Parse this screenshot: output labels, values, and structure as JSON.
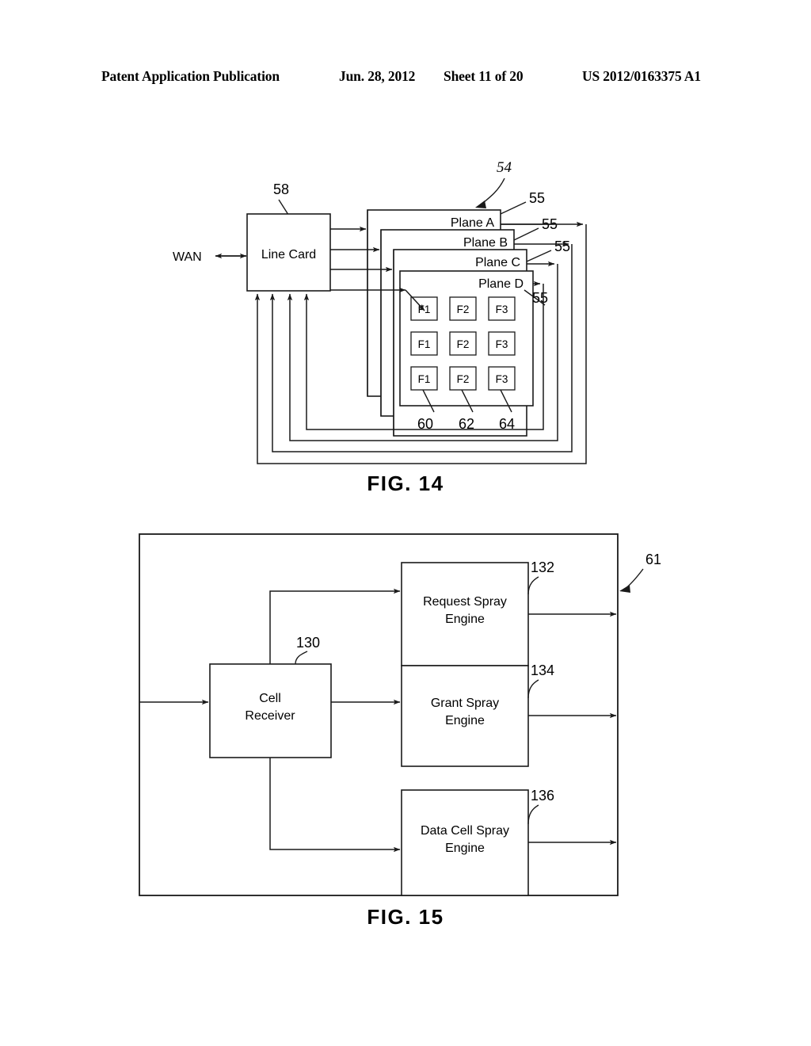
{
  "header": {
    "publication": "Patent Application Publication",
    "date": "Jun. 28, 2012",
    "sheet": "Sheet 11 of 20",
    "number": "US 2012/0163375 A1"
  },
  "figures": [
    {
      "caption": "FIG. 14",
      "id": "fig14",
      "blocks": {
        "line_card": "Line Card",
        "wan": "WAN"
      },
      "planes": [
        {
          "label": "Plane A",
          "ref": "55"
        },
        {
          "label": "Plane B",
          "ref": "55"
        },
        {
          "label": "Plane C",
          "ref": "55"
        },
        {
          "label": "Plane D",
          "ref": "55"
        }
      ],
      "fabric_grid": {
        "columns": [
          "F1",
          "F2",
          "F3"
        ],
        "column_refs": [
          "60",
          "62",
          "64"
        ],
        "rows": 3,
        "cells": [
          [
            "F1",
            "F2",
            "F3"
          ],
          [
            "F1",
            "F2",
            "F3"
          ],
          [
            "F1",
            "F2",
            "F3"
          ]
        ]
      },
      "refs": {
        "assembly": "54",
        "line_card": "58"
      }
    },
    {
      "caption": "FIG. 15",
      "id": "fig15",
      "refs": {
        "assembly": "61"
      },
      "blocks": [
        {
          "label_line1": "Cell",
          "label_line2": "Receiver",
          "ref": "130"
        },
        {
          "label_line1": "Request Spray",
          "label_line2": "Engine",
          "ref": "132"
        },
        {
          "label_line1": "Grant Spray",
          "label_line2": "Engine",
          "ref": "134"
        },
        {
          "label_line1": "Data Cell Spray",
          "label_line2": "Engine",
          "ref": "136"
        }
      ]
    }
  ],
  "colors": {
    "ink": "#1a1a1a",
    "paper": "#ffffff"
  }
}
